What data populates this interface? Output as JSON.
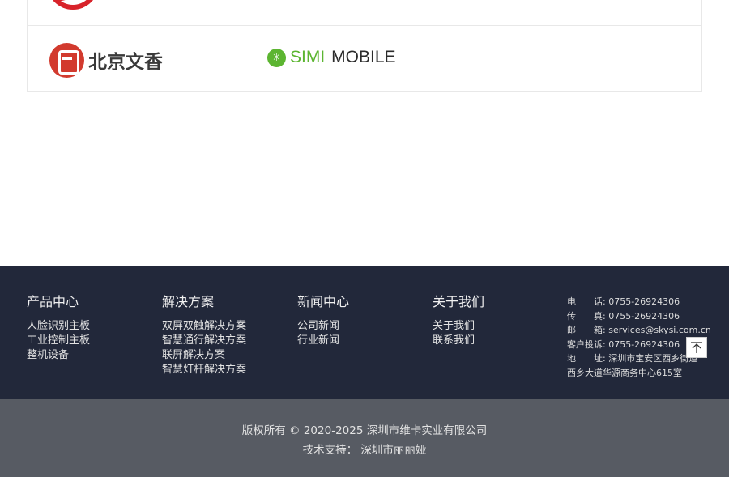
{
  "partners": {
    "logos": [
      {
        "name": "北京文香",
        "text": "北京文香",
        "color": "#d23a2e"
      },
      {
        "name": "SIMI MOBILE",
        "part1": "SIMI",
        "part2": "MOBILE",
        "color": "#5cb531"
      }
    ]
  },
  "footer": {
    "columns": [
      {
        "heading": "产品中心",
        "links": [
          "人脸识别主板",
          "工业控制主板",
          "整机设备"
        ]
      },
      {
        "heading": "解决方案",
        "links": [
          "双屏双触解决方案",
          "智慧通行解决方案",
          "联屏解决方案",
          "智慧灯杆解决方案"
        ]
      },
      {
        "heading": "新闻中心",
        "links": [
          "公司新闻",
          "行业新闻"
        ]
      },
      {
        "heading": "关于我们",
        "links": [
          "关于我们",
          "联系我们"
        ]
      }
    ],
    "contact": {
      "phone_label": "电　　话:",
      "phone": "0755-26924306",
      "fax_label": "传　　真:",
      "fax": "0755-26924306",
      "email_label": "邮　　箱:",
      "email": "services@skysi.com.cn",
      "complaint_label": "客户投诉:",
      "complaint": "0755-26924306",
      "address_label": "地　　址:",
      "address": "深圳市宝安区西乡街道西乡大道华源商务中心615室"
    }
  },
  "copyright": {
    "line1": "版权所有 © 2020-2025 深圳市维卡实业有限公司",
    "line2": "技术支持：  深圳市丽丽娅"
  },
  "colors": {
    "footer_bg": "#22283a",
    "copyright_bg": "#575b63"
  }
}
